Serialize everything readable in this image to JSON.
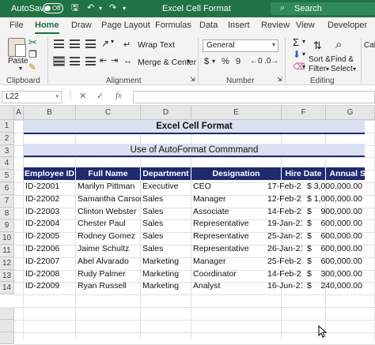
{
  "titlebar": {
    "autosave": "AutoSave",
    "toggle": "Off",
    "save_icon": "save-icon",
    "undo_icon": "undo-icon",
    "redo_icon": "redo-icon",
    "title": "Excel Cell Format",
    "search_placeholder": "Search"
  },
  "tabs": [
    "File",
    "Home",
    "Draw",
    "Page Layout",
    "Formulas",
    "Data",
    "Insert",
    "Review",
    "View",
    "Developer"
  ],
  "ribbon": {
    "clipboard": {
      "paste": "Paste",
      "label": "Clipboard"
    },
    "alignment": {
      "wrap_text": "Wrap Text",
      "merge_center": "Merge & Center",
      "label": "Alignment"
    },
    "number": {
      "format": "General",
      "currency": "$",
      "percent": "%",
      "comma": "9",
      "label": "Number"
    },
    "editing": {
      "sort_filter_1": "Sort &",
      "sort_filter_2": "Filter",
      "find_select_1": "Find &",
      "find_select_2": "Select",
      "label": "Editing"
    },
    "font_peek": "Cali"
  },
  "formula_bar": {
    "name_box": "L22",
    "fx": "fx",
    "content": ""
  },
  "columns": [
    "A",
    "B",
    "C",
    "D",
    "E",
    "F",
    "G"
  ],
  "rows": [
    "1",
    "2",
    "3",
    "4",
    "5",
    "6",
    "7",
    "8",
    "9",
    "10",
    "11",
    "12",
    "13",
    "14"
  ],
  "sheet": {
    "title": "Excel Cell Format",
    "subtitle": "Use of AutoFormat Commmand",
    "headers": [
      "Employee ID",
      "Full Name",
      "Department",
      "Designation",
      "Hire Date",
      "Annual Salary"
    ],
    "records": [
      {
        "id": "ID-22001",
        "name": "Marilyn Pittman",
        "dept": "Executive",
        "desig": "CEO",
        "hire": "17-Feb-21",
        "cur": "$",
        "salary": "3,000,000.00"
      },
      {
        "id": "ID-22002",
        "name": "Samantha Carson",
        "dept": "Sales",
        "desig": "Manager",
        "hire": "12-Feb-21",
        "cur": "$",
        "salary": "1,000,000.00"
      },
      {
        "id": "ID-22003",
        "name": "Clinton Webster",
        "dept": "Sales",
        "desig": "Associate",
        "hire": "14-Feb-21",
        "cur": "$",
        "salary": "900,000.00"
      },
      {
        "id": "ID-22004",
        "name": "Chester Paul",
        "dept": "Sales",
        "desig": "Representative",
        "hire": "19-Jan-21",
        "cur": "$",
        "salary": "600,000.00"
      },
      {
        "id": "ID-22005",
        "name": "Rodney Gomez",
        "dept": "Sales",
        "desig": "Representative",
        "hire": "25-Jan-21",
        "cur": "$",
        "salary": "600,000.00"
      },
      {
        "id": "ID-22006",
        "name": "Jaime Schultz",
        "dept": "Sales",
        "desig": "Representative",
        "hire": "26-Jan-21",
        "cur": "$",
        "salary": "600,000.00"
      },
      {
        "id": "ID-22007",
        "name": "Abel Alvarado",
        "dept": "Marketing",
        "desig": "Manager",
        "hire": "25-Feb-21",
        "cur": "$",
        "salary": "600,000.00"
      },
      {
        "id": "ID-22008",
        "name": "Rudy Palmer",
        "dept": "Marketing",
        "desig": "Coordinator",
        "hire": "14-Feb-21",
        "cur": "$",
        "salary": "300,000.00"
      },
      {
        "id": "ID-22009",
        "name": "Ryan Russell",
        "dept": "Marketing",
        "desig": "Analyst",
        "hire": "16-Jun-21",
        "cur": "$",
        "salary": "240,000.00"
      }
    ]
  },
  "colors": {
    "accent": "#217346",
    "header_fill": "#1f2a6e",
    "band_fill": "#d9e1f2"
  }
}
